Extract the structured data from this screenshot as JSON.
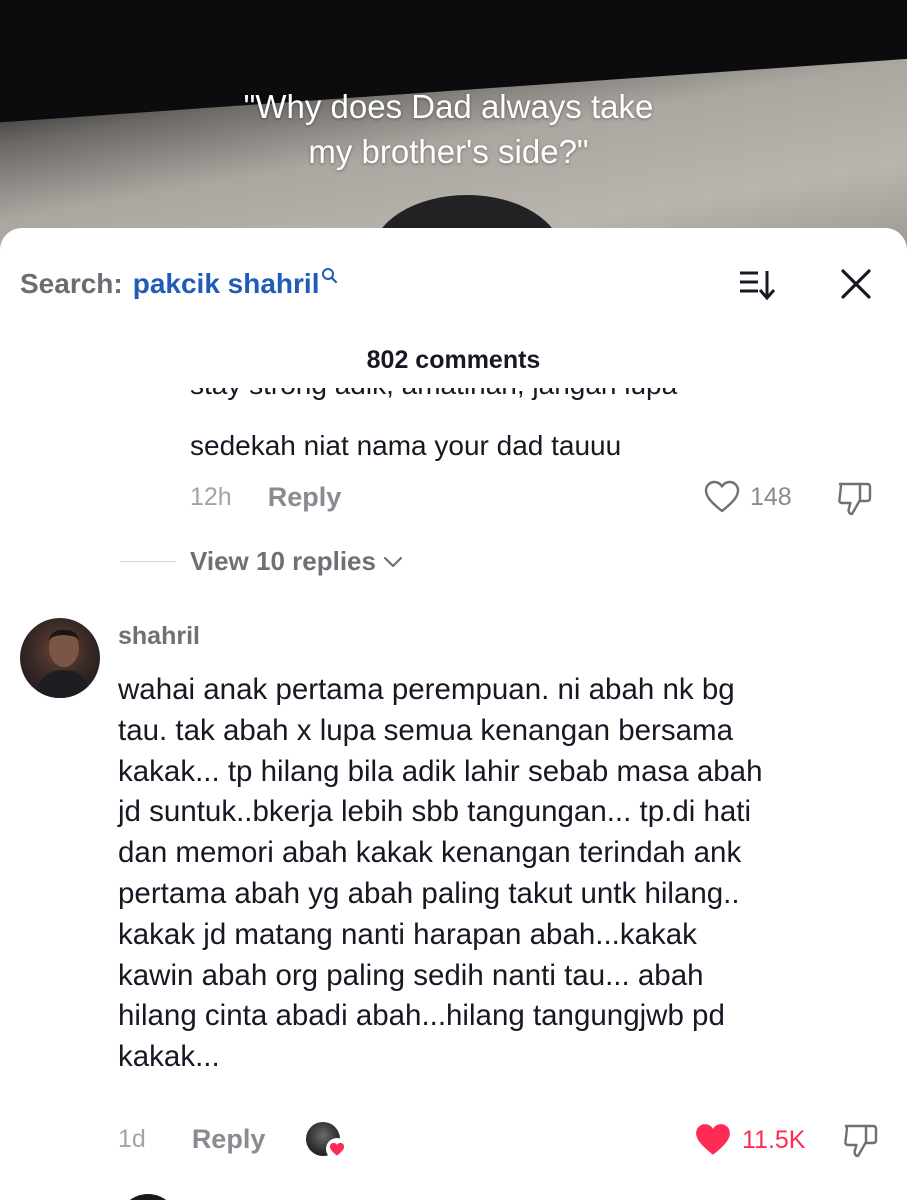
{
  "video": {
    "caption_line1": "\"Why does Dad always take",
    "caption_line2": "my brother's side?\""
  },
  "header": {
    "search_prefix": "Search:",
    "search_query": "pakcik shahril",
    "comment_count": "802 comments"
  },
  "comment1": {
    "cut_text": "stay strong adik, amatinah, jangan lupa",
    "text": "sedekah niat nama your dad tauuu",
    "time": "12h",
    "reply_label": "Reply",
    "likes": "148",
    "view_replies": "View 10 replies"
  },
  "comment2": {
    "username": "shahril",
    "lines": [
      "wahai anak pertama perempuan. ni abah nk bg",
      "tau. tak abah x lupa semua kenangan bersama",
      "kakak... tp hilang bila adik lahir sebab masa abah",
      "jd suntuk..bkerja lebih sbb tangungan... tp.di hati",
      "dan memori abah kakak kenangan terindah ank",
      "pertama abah yg abah paling takut untk hilang..",
      "kakak jd matang nanti harapan abah...kakak",
      "kawin abah org paling sedih nanti tau... abah",
      "hilang cinta abadi abah...hilang tangungjwb pd",
      "kakak..."
    ],
    "time": "1d",
    "reply_label": "Reply",
    "likes": "11.5K"
  },
  "colors": {
    "link_blue": "#1f5bb7",
    "liked_red": "#fe2c55",
    "muted_gray": "#8a8b91"
  },
  "icons": [
    "search-icon",
    "sort-icon",
    "close-icon",
    "heart-icon",
    "dislike-icon",
    "chevron-down-icon"
  ]
}
